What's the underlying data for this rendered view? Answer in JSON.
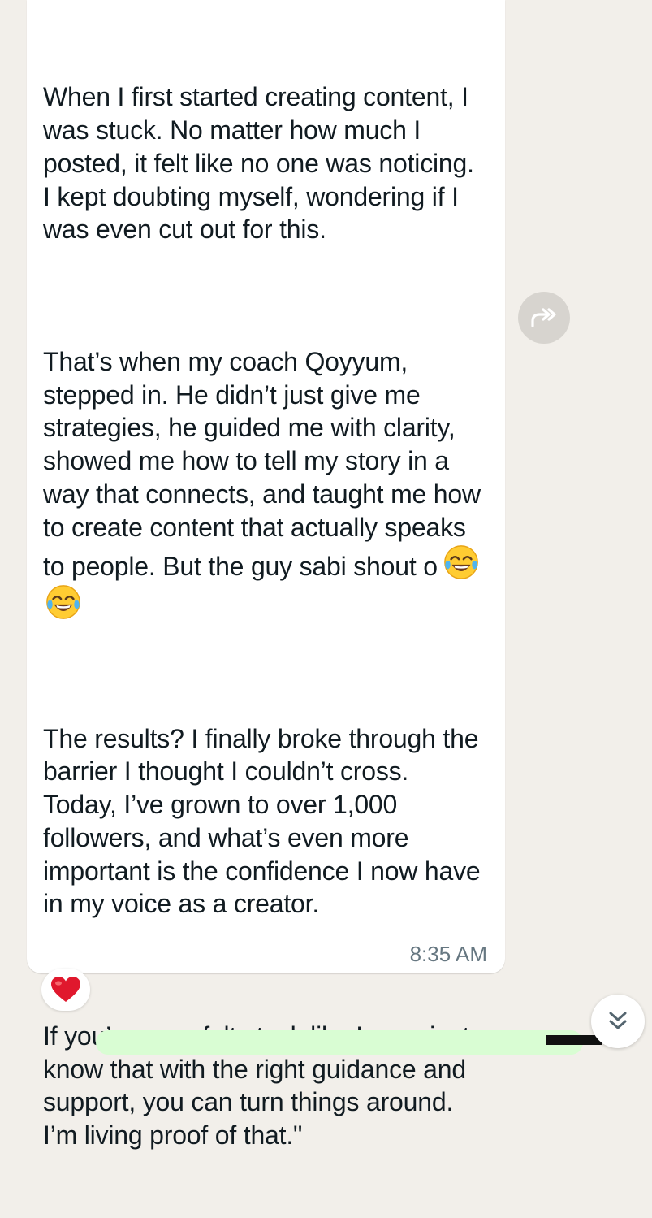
{
  "message": {
    "paragraphs": [
      "When I first started creating content, I was stuck. No matter how much I posted, it felt like no one was noticing. I kept doubting myself, wondering if I was even cut out for this.",
      "That’s when my coach Qoyyum, stepped in. He didn’t just give me strategies, he guided me with clarity, showed me how to tell my story in a way that connects, and taught me how to create content that actually speaks to people. But the guy sabi shout o",
      "The results? I finally broke through the barrier I thought I couldn’t cross. Today, I’ve grown to over 1,000 followers, and what’s even more important is the confidence I now have in my voice as a creator.",
      "If you’ve ever felt stuck like I was, just know that with the right guidance and support, you can turn things around. I’m living proof of that.\""
    ],
    "inline_emojis": [
      "tears-of-joy-emoji",
      "tears-of-joy-emoji"
    ],
    "time": "8:35 AM"
  },
  "reaction": {
    "icon": "red-heart-emoji"
  },
  "icons": {
    "forward": "forward-arrow-icon",
    "scroll_down": "double-chevron-down-icon"
  },
  "colors": {
    "chat_background": "#f2efea",
    "incoming_bubble": "#ffffff",
    "outgoing_bubble": "#d9fdd3",
    "timestamp": "#667781",
    "heart": "#e0182d"
  }
}
